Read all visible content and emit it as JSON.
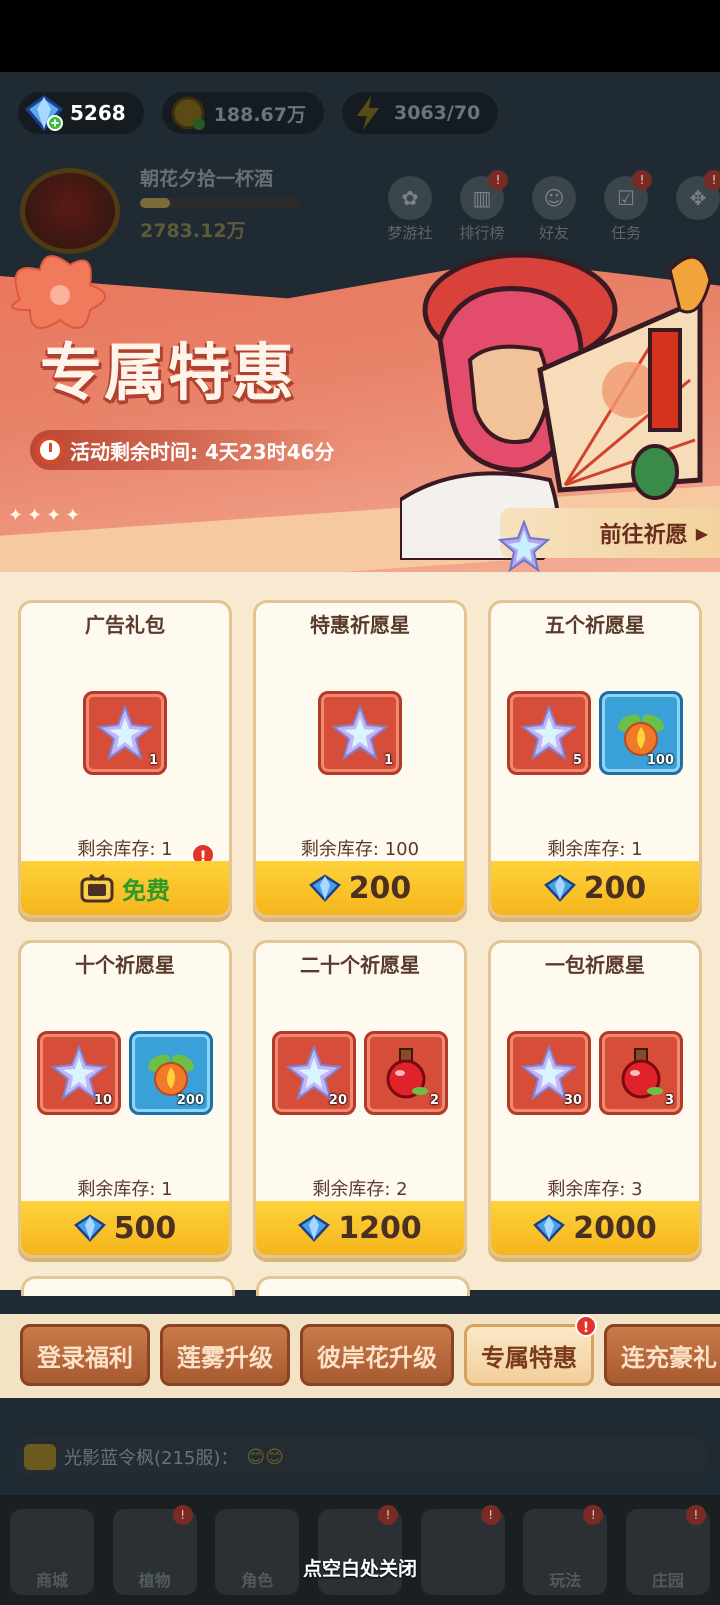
{
  "currencies": [
    {
      "icon": "diamond-icon",
      "value": "5268"
    },
    {
      "icon": "gold-coin-icon",
      "value": "188.67万"
    },
    {
      "icon": "energy-icon",
      "value": "3063/70"
    }
  ],
  "profile": {
    "name": "朝花夕拾一杯酒",
    "money": "2783.12万"
  },
  "top_nav": [
    {
      "label": "梦游社",
      "icon": "dream-club-icon"
    },
    {
      "label": "排行榜",
      "icon": "leaderboard-icon"
    },
    {
      "label": "好友",
      "icon": "friends-icon"
    },
    {
      "label": "任务",
      "icon": "tasks-icon"
    },
    {
      "label": "",
      "icon": "more-icon"
    }
  ],
  "banner": {
    "title": "专属特惠",
    "timer_label": "活动剩余时间: 4天23时46分",
    "wish_button": "前往祈愿",
    "wish_arrow": "▶"
  },
  "packs": [
    {
      "title": "广告礼包",
      "items": [
        {
          "icon": "wish-star-icon",
          "qty": "1",
          "color": "red"
        }
      ],
      "stock": "剩余库存: 1",
      "price": "",
      "free": "免费"
    },
    {
      "title": "特惠祈愿星",
      "items": [
        {
          "icon": "wish-star-icon",
          "qty": "1",
          "color": "red"
        }
      ],
      "stock": "剩余库存: 100",
      "price": "200",
      "free": ""
    },
    {
      "title": "五个祈愿星",
      "items": [
        {
          "icon": "wish-star-icon",
          "qty": "5",
          "color": "red"
        },
        {
          "icon": "fire-seed-icon",
          "qty": "100",
          "color": "blue"
        }
      ],
      "stock": "剩余库存: 1",
      "price": "200",
      "free": ""
    },
    {
      "title": "十个祈愿星",
      "items": [
        {
          "icon": "wish-star-icon",
          "qty": "10",
          "color": "red"
        },
        {
          "icon": "fire-seed-icon",
          "qty": "200",
          "color": "blue"
        }
      ],
      "stock": "剩余库存: 1",
      "price": "500",
      "free": ""
    },
    {
      "title": "二十个祈愿星",
      "items": [
        {
          "icon": "wish-star-icon",
          "qty": "20",
          "color": "red"
        },
        {
          "icon": "potion-icon",
          "qty": "2",
          "color": "red"
        }
      ],
      "stock": "剩余库存: 2",
      "price": "1200",
      "free": ""
    },
    {
      "title": "一包祈愿星",
      "items": [
        {
          "icon": "wish-star-icon",
          "qty": "30",
          "color": "red"
        },
        {
          "icon": "potion-icon",
          "qty": "3",
          "color": "red"
        }
      ],
      "stock": "剩余库存: 3",
      "price": "2000",
      "free": ""
    }
  ],
  "tabs": [
    {
      "label": "登录福利",
      "active": false,
      "badge": false
    },
    {
      "label": "莲雾升级",
      "active": false,
      "badge": false
    },
    {
      "label": "彼岸花升级",
      "active": false,
      "badge": false
    },
    {
      "label": "专属特惠",
      "active": true,
      "badge": true
    },
    {
      "label": "连充豪礼",
      "active": false,
      "badge": false
    }
  ],
  "chat": {
    "text": "光影蓝令枫(215服)：",
    "emoji": "😊😊"
  },
  "bottom_nav": [
    {
      "label": "商城",
      "icon": "shop-icon"
    },
    {
      "label": "植物",
      "icon": "plant-icon"
    },
    {
      "label": "角色",
      "icon": "character-icon"
    },
    {
      "label": "",
      "icon": "battle-icon"
    },
    {
      "label": "",
      "icon": "gift-icon"
    },
    {
      "label": "玩法",
      "icon": "play-icon"
    },
    {
      "label": "庄园",
      "icon": "manor-icon"
    }
  ],
  "close_hint": "点空白处关闭",
  "colors": {
    "accent": "#e9765b",
    "panel": "#f8ead0",
    "price_bar": "#ffd23a"
  }
}
